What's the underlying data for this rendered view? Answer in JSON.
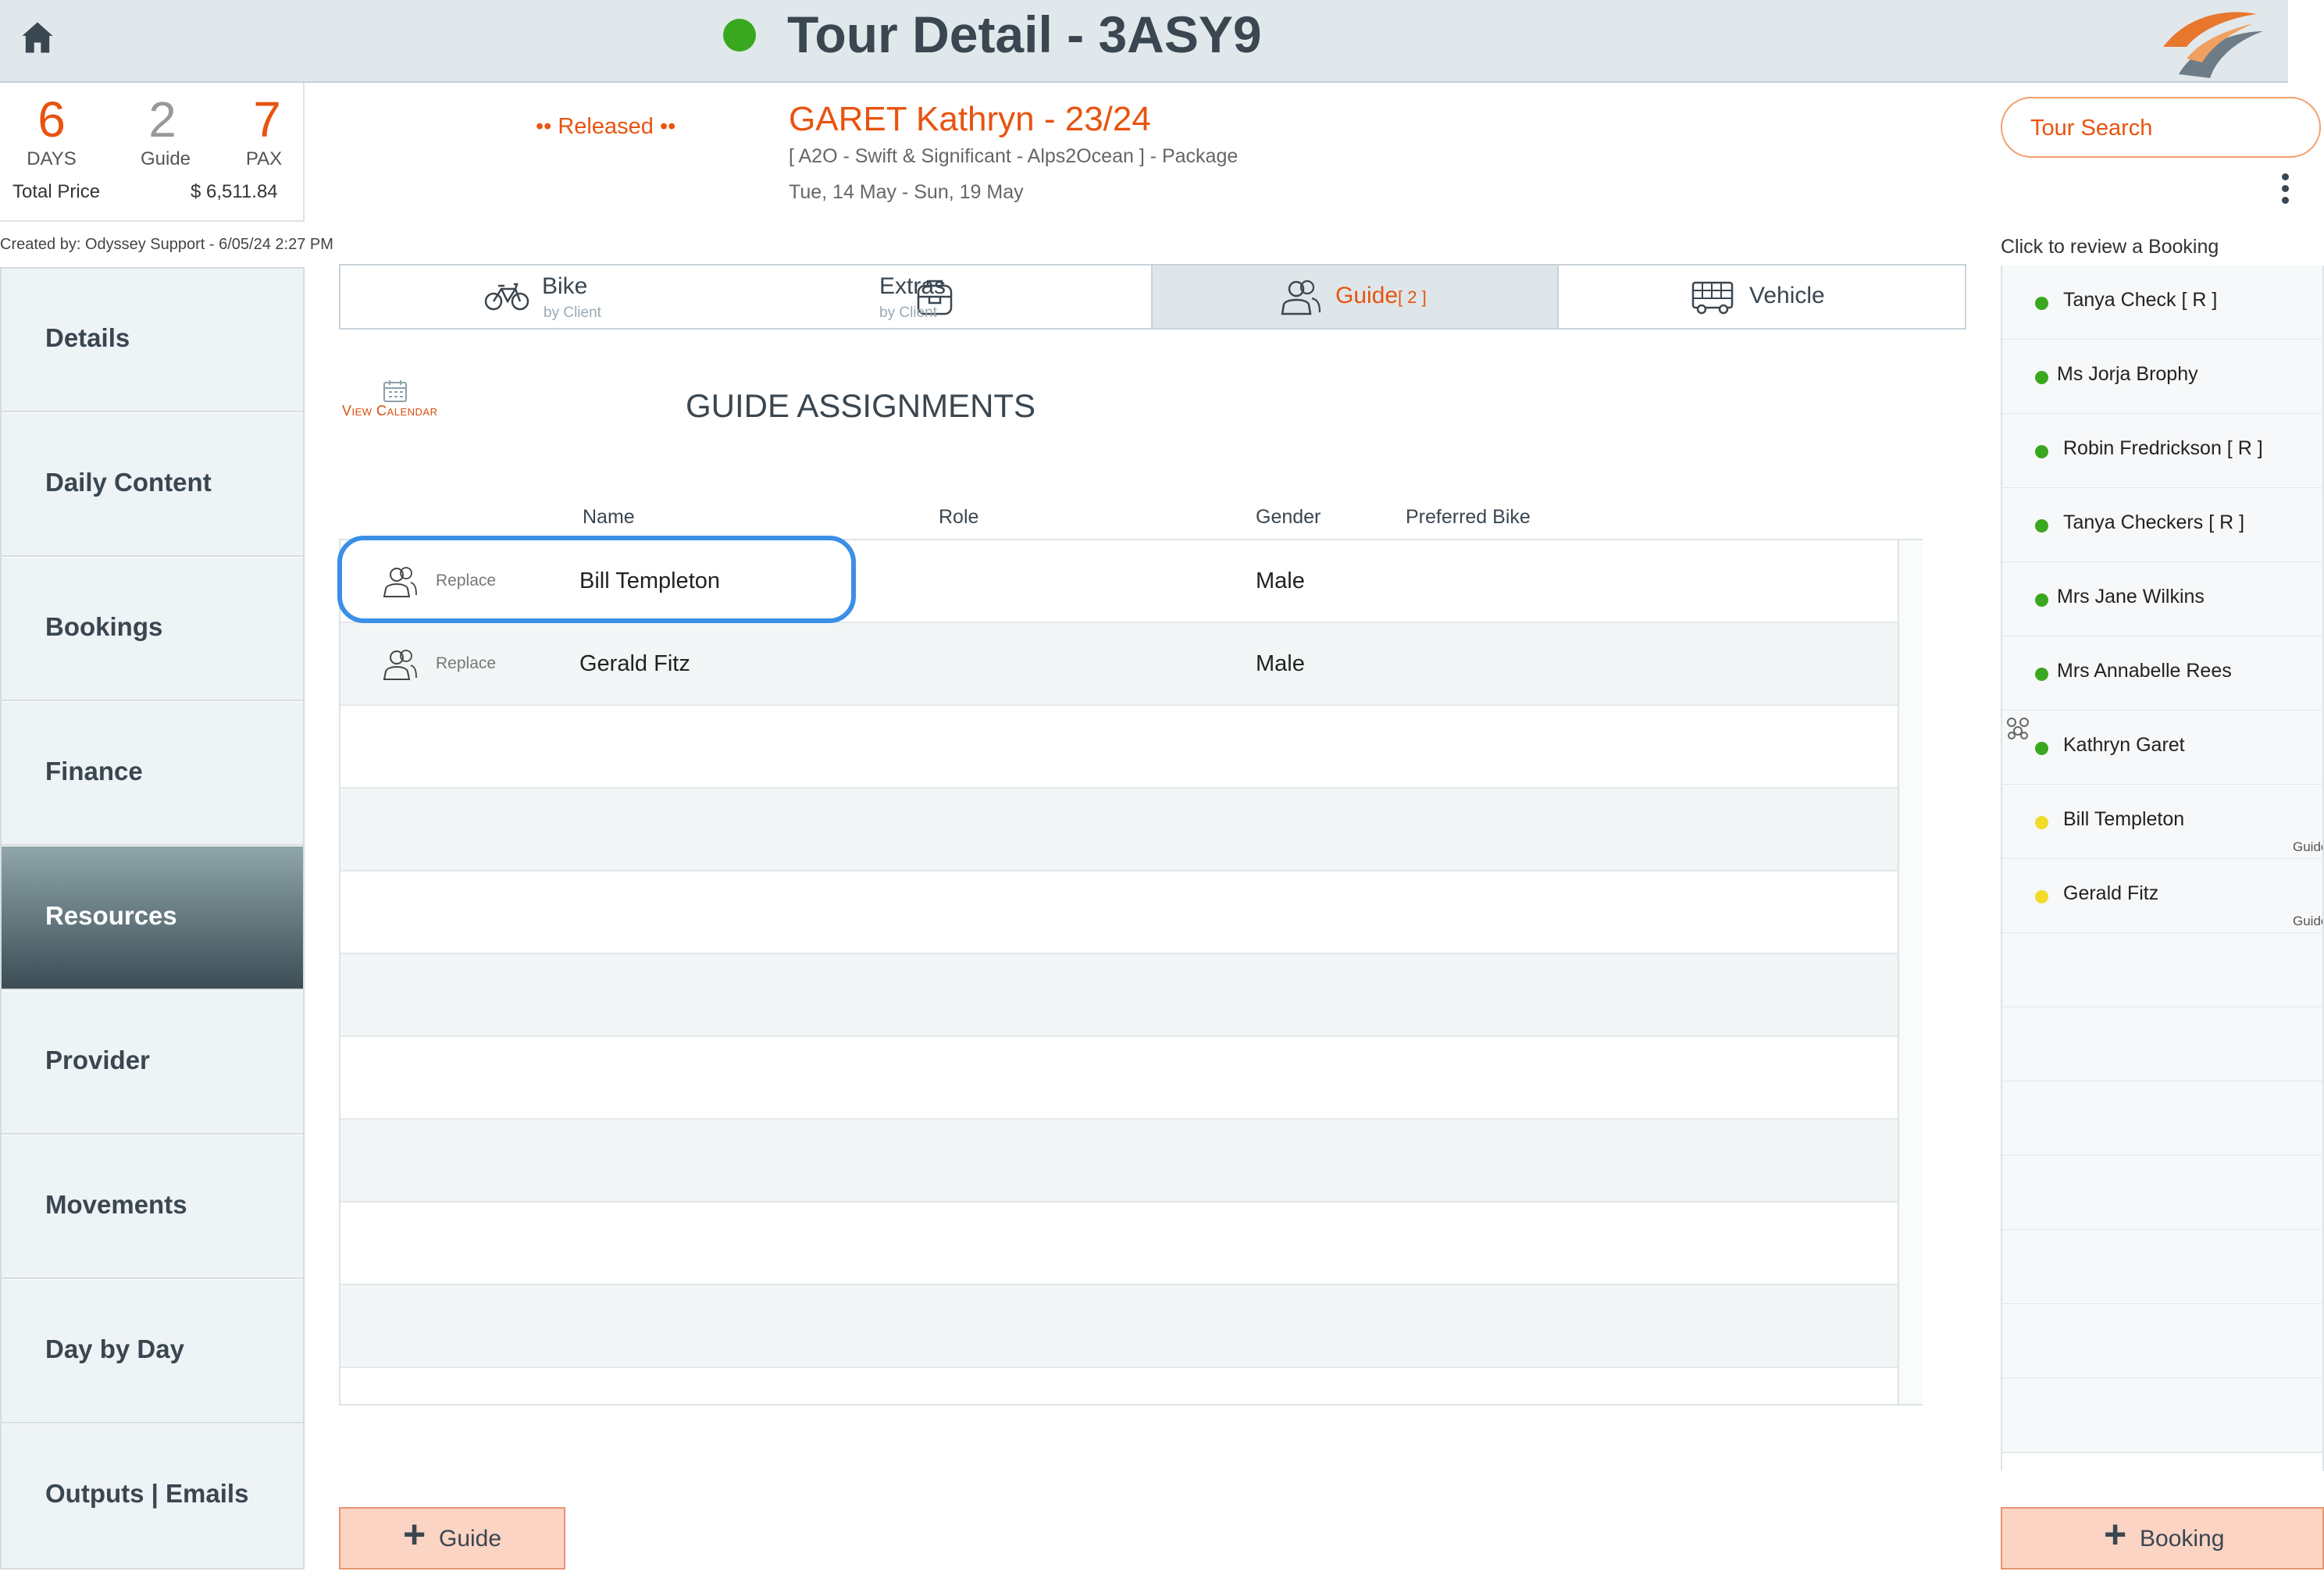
{
  "header": {
    "title": "Tour Detail - 3ASY9",
    "status_color": "#3aa81f"
  },
  "summary": {
    "days_value": "6",
    "days_label": "DAYS",
    "guide_value": "2",
    "guide_label": "Guide",
    "pax_value": "7",
    "pax_label": "PAX",
    "total_price_label": "Total Price",
    "total_price_value": "$ 6,511.84",
    "created_by": "Created by: Odyssey Support - 6/05/24 2:27 PM"
  },
  "tour": {
    "status": "•• Released ••",
    "client_name": "GARET Kathryn - 23/24",
    "description": "[ A2O - Swift & Significant - Alps2Ocean ] - Package",
    "dates": "Tue, 14 May  - Sun, 19 May"
  },
  "tour_search": {
    "label": "Tour Search"
  },
  "sidebar": {
    "items": [
      {
        "label": "Details"
      },
      {
        "label": "Daily Content"
      },
      {
        "label": "Bookings"
      },
      {
        "label": "Finance"
      },
      {
        "label": "Resources",
        "active": true
      },
      {
        "label": "Provider"
      },
      {
        "label": "Movements"
      },
      {
        "label": "Day by Day"
      },
      {
        "label": "Outputs | Emails"
      }
    ]
  },
  "tabs": {
    "bike": {
      "label": "Bike",
      "sub": "by Client",
      "icon": "bicycle-icon"
    },
    "extras": {
      "label": "Extras",
      "sub": "by Client",
      "icon": "backpack-icon"
    },
    "guide": {
      "label": "Guide",
      "count": "[ 2 ]",
      "icon": "people-icon"
    },
    "vehicle": {
      "label": "Vehicle",
      "icon": "bus-icon"
    }
  },
  "guide_assignments": {
    "view_calendar": "View Calendar",
    "heading": "GUIDE ASSIGNMENTS",
    "columns": {
      "name": "Name",
      "role": "Role",
      "gender": "Gender",
      "preferred_bike": "Preferred Bike"
    },
    "rows": [
      {
        "action": "Replace",
        "name": "Bill Templeton",
        "role": "",
        "gender": "Male",
        "preferred_bike": ""
      },
      {
        "action": "Replace",
        "name": "Gerald Fitz",
        "role": "",
        "gender": "Male",
        "preferred_bike": ""
      }
    ]
  },
  "buttons": {
    "add_guide": "Guide",
    "add_booking": "Booking",
    "accent": "#e8530f"
  },
  "bookings_panel": {
    "label": "Click to review a Booking",
    "items": [
      {
        "name": "Tanya Check  [ R ]",
        "dot": "#3aa81f",
        "role": ""
      },
      {
        "name": "Ms Jorja Brophy",
        "dot": "#3aa81f",
        "role": ""
      },
      {
        "name": "Robin Fredrickson  [ R ]",
        "dot": "#3aa81f",
        "role": ""
      },
      {
        "name": "Tanya Checkers  [ R ]",
        "dot": "#3aa81f",
        "role": ""
      },
      {
        "name": "Mrs Jane Wilkins",
        "dot": "#3aa81f",
        "role": ""
      },
      {
        "name": "Mrs Annabelle Rees",
        "dot": "#3aa81f",
        "role": ""
      },
      {
        "name": "Kathryn Garet",
        "dot": "#3aa81f",
        "role": ""
      },
      {
        "name": "Bill Templeton",
        "dot": "#f2dc2a",
        "role": "Guide"
      },
      {
        "name": "Gerald Fitz",
        "dot": "#f2dc2a",
        "role": "Guide"
      }
    ]
  }
}
